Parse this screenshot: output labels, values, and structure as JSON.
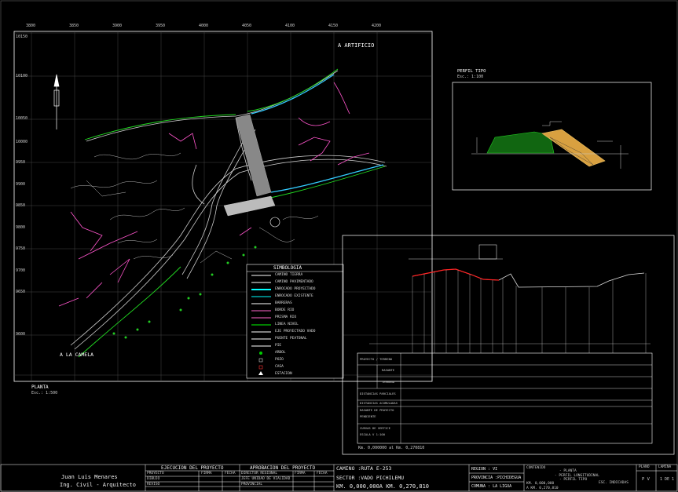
{
  "plan": {
    "direction_north": "A ARTIFICIO",
    "direction_south": "A LA CAMELA",
    "title": "PLANTA",
    "scale": "Esc.: 1:500",
    "grid_top": [
      "3800",
      "3850",
      "3900",
      "3950",
      "4000",
      "4050",
      "4100",
      "4150",
      "4200"
    ],
    "grid_left": [
      "10150",
      "10100",
      "10050",
      "10000",
      "9950",
      "9900",
      "9850",
      "9800",
      "9750",
      "9700",
      "9650",
      "9600"
    ]
  },
  "legend": {
    "title": "SIMBOLOGIA",
    "items": [
      "CAMINO TIERRA",
      "CAMINO PAVIMENTADO",
      "ENROCADO PROYECTADO",
      "ENROCADO EXISTENTE",
      "BARRERAS",
      "BORDE RIO",
      "PRISMA RIO",
      "LINEA NIVEL",
      "EJE PROYECTADO VADO",
      "PUENTE PEATONAL",
      "PIE",
      "ARBOL",
      "POZO",
      "CASA",
      "ESTACION"
    ],
    "colors": [
      "#ffffff",
      "#ffffff",
      "#00ffff",
      "#00ffff",
      "#ffffff",
      "#ff66cc",
      "#ff66cc",
      "#00ff00",
      "#ffffff",
      "#ffffff",
      "#ffffff",
      "#00cc00",
      "#ffffff",
      "#ff3333",
      "#ffffff"
    ]
  },
  "section": {
    "title": "PERFIL TIPO",
    "scale": "Esc.: 1:100"
  },
  "profile": {
    "chainage": "Km. 0,000000 al Km. 0,270810",
    "row_labels": [
      "PROYECTO / TERRENO",
      "RASANTE",
      "TERRENO",
      "DISTANCIAS PARCIALES",
      "DISTANCIAS ACUMULADAS",
      "RASANTE DE PROYECTO",
      "PENDIENTE",
      "CURVAS DE VERTICE",
      "ESCALA V 1:100"
    ]
  },
  "title_block": {
    "author_name": "Juan Luis Menares",
    "author_title": "Ing. Civil - Arquitecto",
    "execution_header": "EJECUCION DEL PROYECTO",
    "approval_header": "APROBACION DEL PROYECTO",
    "exec_rows": [
      "PROYECTO",
      "DIBUJO",
      "REVISO"
    ],
    "approval_rows": [
      "DIRECTOR REGIONAL",
      "JEFE UNIDAD DE VIALIDAD",
      "PROVINCIAL"
    ],
    "col_firma": "FIRMA",
    "col_fecha": "FECHA",
    "road": "CAMINO :RUTA E-253",
    "sector": "SECTOR :VADO PICHILEMU",
    "km": "KM. 0,000,000A KM. 0,270,810",
    "region": "REGION : VI",
    "province": "PROVINCIA :PICHIDEGUA",
    "commune": "COMUNA : LA LIGUA",
    "km_small_1": "KM. 0,000,000",
    "km_small_2": "A KM. 0,270,810",
    "contents_header": "CONTENIDO",
    "contents_items": [
      "- PLANTA",
      "- PERFIL LONGITUDINAL",
      "- PERFIL TIPO"
    ],
    "scale_note": "ESC. INDICADAS",
    "plano_header": "PLANO",
    "plano_value": "P V",
    "lamina_header": "LAMINA",
    "lamina_value": "1 DE 1"
  }
}
